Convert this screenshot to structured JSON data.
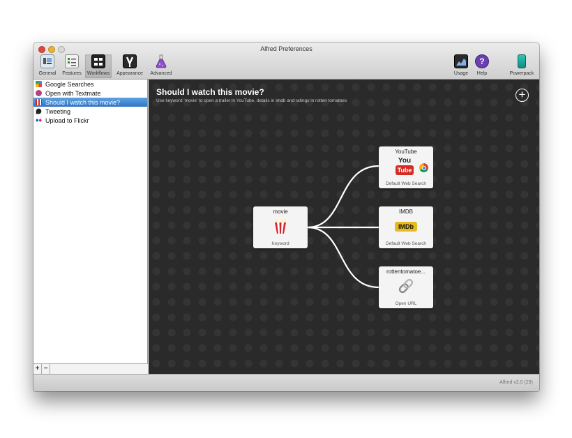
{
  "window": {
    "title": "Alfred Preferences"
  },
  "toolbar": {
    "left": [
      {
        "label": "General",
        "icon": "general-icon"
      },
      {
        "label": "Features",
        "icon": "features-icon"
      },
      {
        "label": "Workflows",
        "icon": "workflows-icon",
        "selected": true
      },
      {
        "label": "Appearance",
        "icon": "appearance-icon"
      },
      {
        "label": "Advanced",
        "icon": "advanced-flask-icon"
      }
    ],
    "right": [
      {
        "label": "Usage",
        "icon": "usage-chart-icon"
      },
      {
        "label": "Help",
        "icon": "help-icon"
      },
      {
        "label": "Powerpack",
        "icon": "powerpack-icon"
      }
    ]
  },
  "sidebar": {
    "items": [
      {
        "label": "Google Searches",
        "icon": "google-icon"
      },
      {
        "label": "Open with Textmate",
        "icon": "textmate-icon"
      },
      {
        "label": "Should I watch this movie?",
        "icon": "popcorn-icon",
        "selected": true
      },
      {
        "label": "Tweeting",
        "icon": "bird-icon"
      },
      {
        "label": "Upload to Flickr",
        "icon": "flickr-icon"
      }
    ],
    "add_label": "+",
    "remove_label": "−"
  },
  "workflow": {
    "title": "Should I watch this movie?",
    "description": "Use keyword 'movie' to open a trailer in YouTube, details in imdb and ratings in rotten tomatoes",
    "add_button": "+",
    "nodes": {
      "keyword": {
        "title": "movie",
        "subtitle": "Keyword",
        "icon": "popcorn-icon"
      },
      "youtube": {
        "title": "YouTube",
        "subtitle": "Default Web Search",
        "icon": "youtube-icon",
        "logo_top": "You",
        "logo_bottom": "Tube"
      },
      "imdb": {
        "title": "IMDB",
        "subtitle": "Default Web Search",
        "icon": "imdb-icon",
        "logo": "IMDb"
      },
      "rotten": {
        "title": "rottentomatoe...",
        "subtitle": "Open URL",
        "icon": "chain-link-icon"
      }
    }
  },
  "status": {
    "version": "Alfred v2.0 (29)"
  },
  "colors": {
    "selection": "#3478cb",
    "canvas": "#2a2a2a",
    "connector": "#ffffff"
  }
}
